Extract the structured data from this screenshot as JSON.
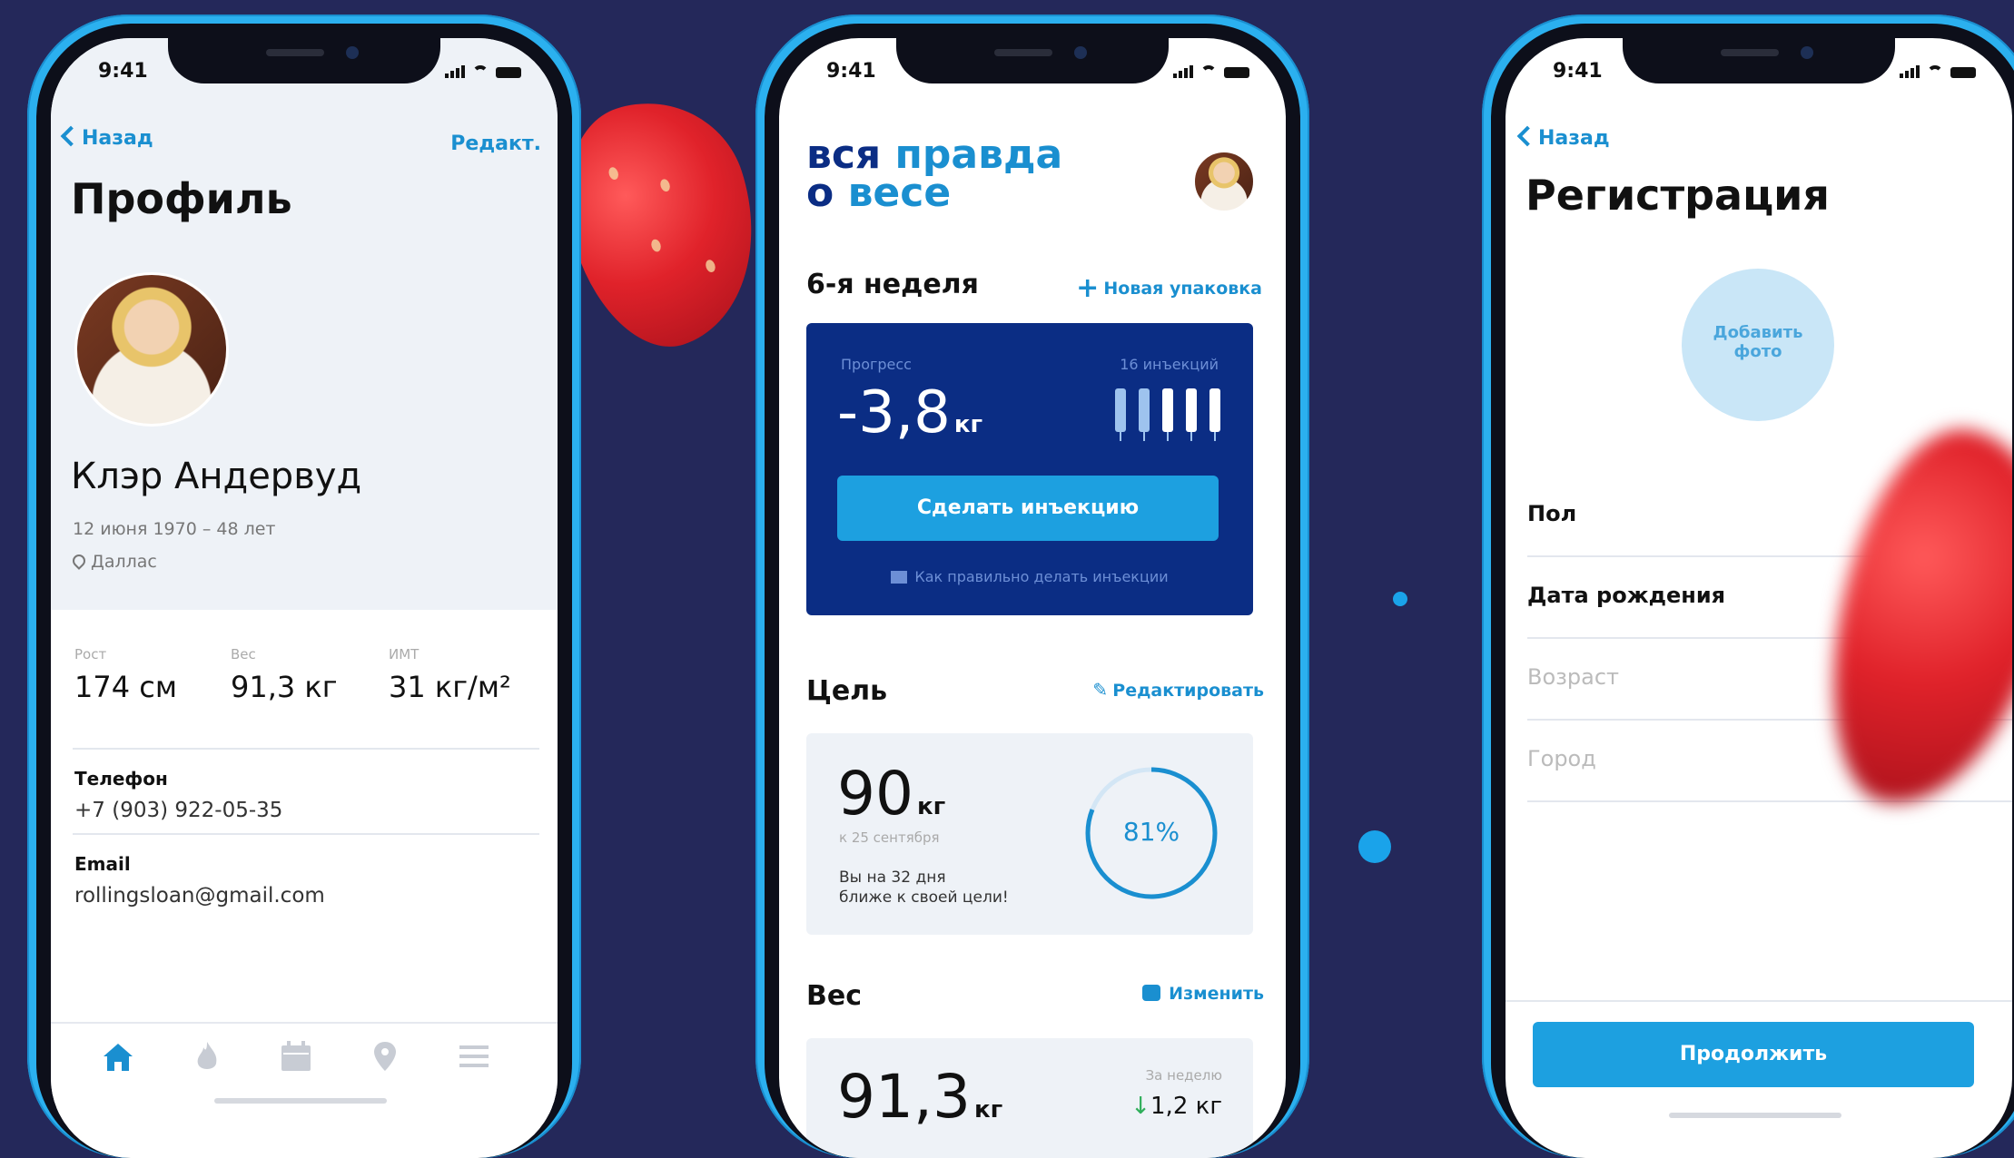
{
  "colors": {
    "background": "#24285a",
    "accent": "#1a8fd0",
    "dark_card": "#0b2d84",
    "frame": "#2bb0ef"
  },
  "status_time": "9:41",
  "profile": {
    "back": "Назад",
    "edit": "Редакт.",
    "title": "Профиль",
    "name": "Клэр Андервуд",
    "birth": "12 июня 1970 – 48 лет",
    "city": "Даллас",
    "stats": [
      {
        "label": "Рост",
        "value": "174 см"
      },
      {
        "label": "Вес",
        "value": "91,3 кг"
      },
      {
        "label": "ИМТ",
        "value": "31 кг/м²"
      }
    ],
    "phone_label": "Телефон",
    "phone_value": "+7 (903) 922-05-35",
    "email_label": "Email",
    "email_value": "rollingsloan@gmail.com",
    "tabs": [
      "home-icon",
      "flame-icon",
      "calendar-icon",
      "map-pin-icon",
      "menu-icon"
    ]
  },
  "dashboard": {
    "brand_line1_a": "вся",
    "brand_line1_b": "правда",
    "brand_line2_a": "о",
    "brand_line2_b": "весе",
    "week": "6-я неделя",
    "new_pack": "Новая упаковка",
    "progress_label": "Прогресс",
    "progress_value": "-3,8",
    "progress_unit": "кг",
    "injections_label": "16 инъекций",
    "inject_button": "Сделать инъекцию",
    "howto": "Как правильно делать инъекции",
    "goal_title": "Цель",
    "goal_edit": "Редактировать",
    "goal_value": "90",
    "goal_unit": "кг",
    "goal_date": "к 25 сентября",
    "goal_msg_1": "Вы на 32 дня",
    "goal_msg_2": "ближе к своей цели!",
    "goal_percent": "81%",
    "goal_progress": 0.81,
    "weight_title": "Вес",
    "weight_change": "Изменить",
    "weight_value": "91,3",
    "weight_unit": "кг",
    "weekly_label": "За неделю",
    "weekly_value": "1,2 кг"
  },
  "registration": {
    "back": "Назад",
    "title": "Регистрация",
    "photo_1": "Добавить",
    "photo_2": "фото",
    "fields": [
      "Пол",
      "Дата рождения",
      "Возраст",
      "Город"
    ],
    "continue": "Продолжить"
  }
}
